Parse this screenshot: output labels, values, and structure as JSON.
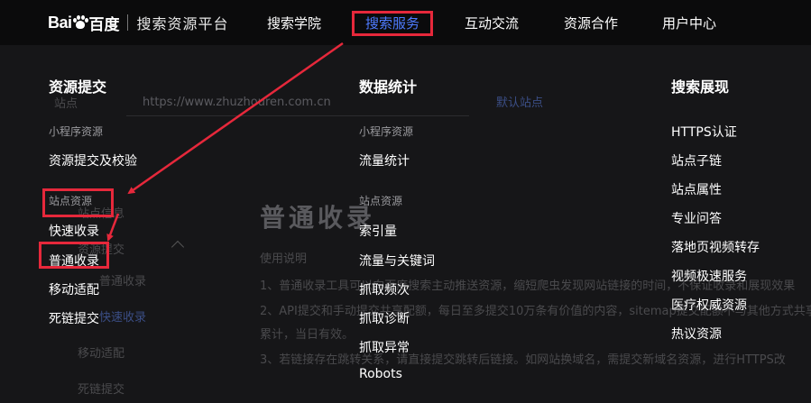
{
  "header": {
    "logo_text_bai": "Bai",
    "logo_text_du": "百度",
    "logo_title": "搜索资源平台",
    "nav": [
      {
        "label": "搜索学院",
        "active": false
      },
      {
        "label": "搜索服务",
        "active": true
      },
      {
        "label": "互动交流",
        "active": false
      },
      {
        "label": "资源合作",
        "active": false
      },
      {
        "label": "用户中心",
        "active": false
      }
    ]
  },
  "background_page": {
    "site_label": "站点",
    "site_url": "https://www.zhuzhouren.com.cn",
    "default_site_link": "默认站点",
    "page_title": "普通收录",
    "usage_title": "使用说明",
    "para1": "1、普通收录工具可以向百度搜索主动推送资源，缩短爬虫发现网站链接的时间，不保证收录和展现效果",
    "para2": "2、API提交和手动提交共享配额，每日至多提交10万条有价值的内容，sitemap提交配额不与其他方式共享",
    "para2b": "累计，当日有效。",
    "para3": "3、若链接存在跳转关系，请直接提交跳转后链接。如网站换域名，需提交新域名资源，进行HTTPS改",
    "side_items": [
      "站点信息",
      "资源提交",
      "普通收录",
      "快速收录",
      "移动适配",
      "死链提交"
    ]
  },
  "menu": {
    "columns": [
      {
        "heading": "资源提交",
        "groups": [
          {
            "label": "小程序资源",
            "items": [
              "资源提交及校验"
            ]
          },
          {
            "label": "站点资源",
            "items": [
              "快速收录",
              "普通收录",
              "移动适配",
              "死链提交"
            ]
          }
        ]
      },
      {
        "heading": "数据统计",
        "groups": [
          {
            "label": "小程序资源",
            "items": [
              "流量统计"
            ]
          },
          {
            "label": "站点资源",
            "items": [
              "索引量",
              "流量与关键词",
              "抓取频次",
              "抓取诊断",
              "抓取异常",
              "Robots"
            ]
          }
        ]
      },
      {
        "heading": "搜索展现",
        "groups": [
          {
            "label": "",
            "items": [
              "HTTPS认证",
              "站点子链",
              "站点属性",
              "专业问答",
              "落地页视频转存",
              "视频极速服务",
              "医疗权威资源",
              "热议资源"
            ]
          }
        ]
      }
    ]
  },
  "colors": {
    "accent": "#4e7bff",
    "annotation_red": "#e6283b",
    "nav_background": "#0b0b0c",
    "menu_background": "#161618"
  }
}
